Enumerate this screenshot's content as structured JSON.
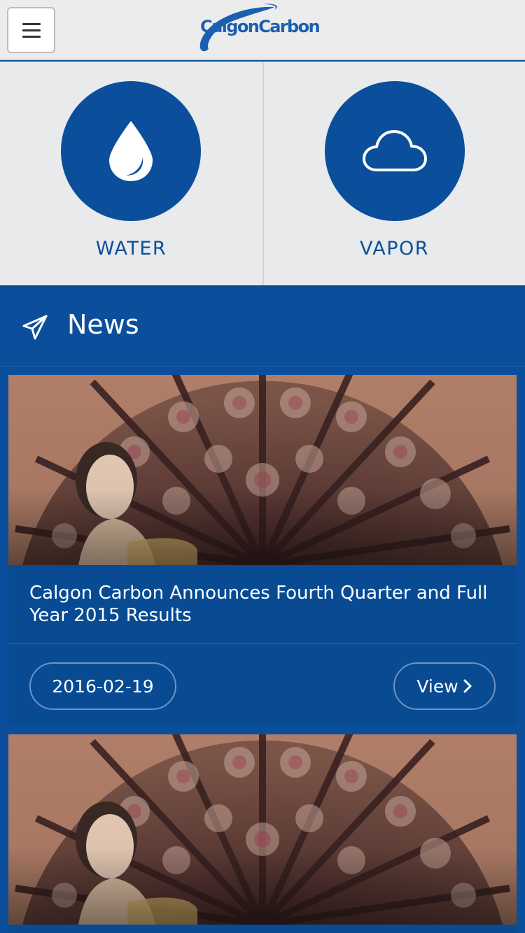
{
  "header": {
    "logo_text": "CalgonCarbon",
    "menu_icon": "hamburger-menu-icon",
    "colors": {
      "background": "#ececec",
      "logo": "#1b5fb0"
    }
  },
  "categories": [
    {
      "label": "WATER",
      "icon": "water-drop-icon"
    },
    {
      "label": "VAPOR",
      "icon": "cloud-icon"
    }
  ],
  "news": {
    "title": "News",
    "icon": "paper-plane-icon",
    "items": [
      {
        "title": "Calgon Carbon Announces Fourth Quarter and Full Year 2015 Results",
        "date": "2016-02-19",
        "view_label": "View",
        "view_icon": "chevron-right-icon",
        "image": "rose-window-portrait-image"
      },
      {
        "image": "rose-window-portrait-image"
      }
    ]
  },
  "colors": {
    "primary": "#0b4f9c",
    "panel": "#e8eaeb",
    "text_on_primary": "#ffffff"
  }
}
